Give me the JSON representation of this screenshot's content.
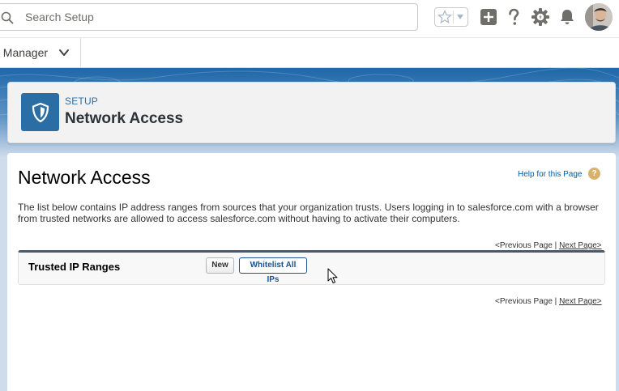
{
  "header": {
    "search_placeholder": "Search Setup",
    "icons": [
      "search-icon",
      "star-icon",
      "chevron-down-icon",
      "add-icon",
      "help-icon",
      "setup-gear-icon",
      "bell-icon",
      "avatar"
    ]
  },
  "app_nav": {
    "app_name": "t Manager"
  },
  "page_header": {
    "eyebrow": "SETUP",
    "title": "Network Access"
  },
  "content": {
    "title": "Network Access",
    "help_link": "Help for this Page",
    "help_icon_glyph": "?",
    "description": "The list below contains IP address ranges from sources that your organization trusts. Users logging in to salesforce.com with a browser from trusted networks are allowed to access salesforce.com without having to activate their computers.",
    "pager": {
      "previous": "<Previous Page",
      "separator": "|",
      "next": "Next Page>"
    },
    "list": {
      "title": "Trusted IP Ranges",
      "new_button": "New",
      "whitelist_button": "Whitelist All IPs"
    }
  },
  "colors": {
    "brand_blue": "#2a6ea5",
    "link_blue": "#015ba7",
    "background_band": "#cfdcec",
    "icon_gray": "#706e6b"
  }
}
